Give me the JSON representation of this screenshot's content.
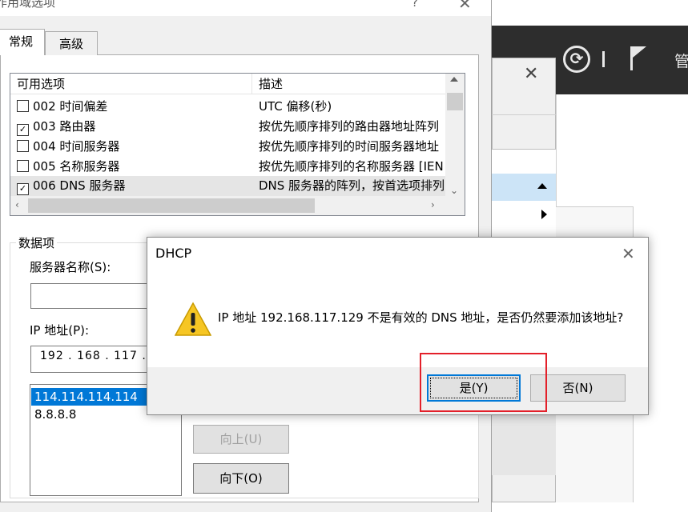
{
  "background": {
    "manage_label": "管",
    "refresh_glyph": "⟳"
  },
  "options_dialog": {
    "title": "作用域选项",
    "help_glyph": "?",
    "close_glyph": "✕",
    "tabs": [
      {
        "label": "常规",
        "active": true
      },
      {
        "label": "高级",
        "active": false
      }
    ],
    "list": {
      "columns": [
        "可用选项",
        "描述"
      ],
      "rows": [
        {
          "checked": false,
          "option": "002 时间偏差",
          "description": "UTC 偏移(秒)"
        },
        {
          "checked": true,
          "option": "003 路由器",
          "description": "按优先顺序排列的路由器地址阵列"
        },
        {
          "checked": false,
          "option": "004 时间服务器",
          "description": "按优先顺序排列的时间服务器地址"
        },
        {
          "checked": false,
          "option": "005 名称服务器",
          "description": "按优先顺序排列的名称服务器 [IEN"
        },
        {
          "checked": true,
          "option": "006 DNS 服务器",
          "description": "DNS 服务器的阵列，按首选项排列"
        }
      ]
    },
    "data_group": {
      "label": "数据项",
      "server_name_label": "服务器名称(S):",
      "server_name_value": "",
      "ip_label": "IP 地址(P):",
      "ip_value": "192 . 168 . 117 .",
      "ip_list": [
        {
          "value": "114.114.114.114",
          "selected": true
        },
        {
          "value": "8.8.8.8",
          "selected": false
        }
      ],
      "move_up_label": "向上(U)",
      "move_down_label": "向下(O)"
    }
  },
  "message_box": {
    "title": "DHCP",
    "close_glyph": "✕",
    "message": "IP 地址 192.168.117.129 不是有效的 DNS 地址，是否仍然要添加该地址?",
    "yes_label": "是(Y)",
    "no_label": "否(N)"
  },
  "colors": {
    "selection_blue": "#0078d7",
    "highlight_red": "#e3202a",
    "dark_toolbar": "#2d2d2d"
  }
}
